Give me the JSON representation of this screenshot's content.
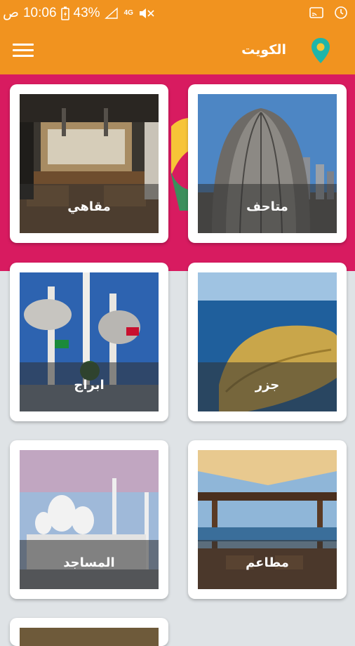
{
  "status_bar": {
    "period": "ص",
    "time": "10:06",
    "battery": "43%",
    "network": "4G"
  },
  "header": {
    "title": "الكويت",
    "menu_icon": "hamburger-menu-icon",
    "location_icon": "location-pin-icon"
  },
  "categories": [
    {
      "label": "متاحف"
    },
    {
      "label": "مقاهي"
    },
    {
      "label": "جزر"
    },
    {
      "label": "ابراج"
    },
    {
      "label": "مطاعم"
    },
    {
      "label": "المساجد"
    }
  ],
  "colors": {
    "primary": "#f1931f",
    "accent_band": "#d81b60",
    "background": "#dfe3e6",
    "pin_fill": "#1fb5a9"
  }
}
